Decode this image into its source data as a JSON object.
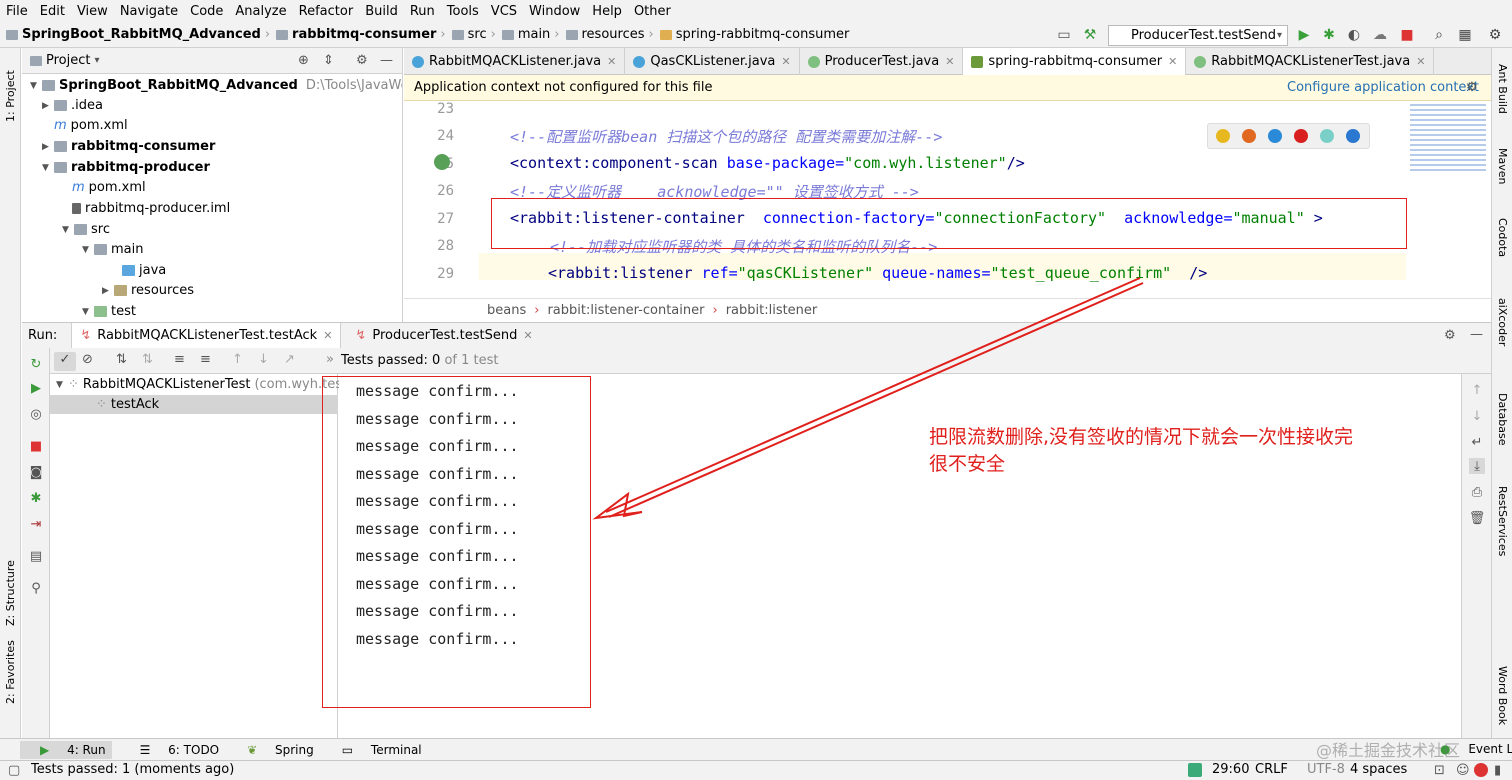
{
  "menu": [
    "File",
    "Edit",
    "View",
    "Navigate",
    "Code",
    "Analyze",
    "Refactor",
    "Build",
    "Run",
    "Tools",
    "VCS",
    "Window",
    "Help",
    "Other"
  ],
  "breadcrumbs": [
    "SpringBoot_RabbitMQ_Advanced",
    "rabbitmq-consumer",
    "src",
    "main",
    "resources",
    "spring-rabbitmq-consumer"
  ],
  "run_config": "ProducerTest.testSend",
  "left_strip": {
    "project": "1: Project",
    "structure": "Z: Structure",
    "favorites": "2: Favorites"
  },
  "right_strip": {
    "ant": "Ant Build",
    "maven": "Maven",
    "codota": "Codota",
    "aixcoder": "aiXcoder",
    "database": "Database",
    "rest": "RestServices",
    "wordbook": "Word Book"
  },
  "project": {
    "title": "Project",
    "root": "SpringBoot_RabbitMQ_Advanced",
    "root_path": "D:\\Tools\\JavaWorkSpace",
    "items": [
      ".idea",
      "pom.xml",
      "rabbitmq-consumer",
      "rabbitmq-producer",
      "pom.xml",
      "rabbitmq-producer.iml",
      "src",
      "main",
      "java",
      "resources",
      "test"
    ]
  },
  "tabs": [
    "RabbitMQACKListener.java",
    "QasCKListener.java",
    "ProducerTest.java",
    "spring-rabbitmq-consumer",
    "RabbitMQACKListenerTest.java"
  ],
  "banner": {
    "text": "Application context not configured for this file",
    "link": "Configure application context"
  },
  "line_numbers": [
    "23",
    "24",
    "25",
    "26",
    "27",
    "28",
    "29"
  ],
  "code": {
    "l24": "<!--配置监听器bean 扫描这个包的路径 配置类需要加注解-->",
    "l25_tag": "<context:component-scan",
    "l25_attr": " base-package=",
    "l25_val": "\"com.wyh.listener\"",
    "l25_end": "/>",
    "l26": "<!--定义监听器    acknowledge=\"\" 设置签收方式 -->",
    "l27_tag": "<rabbit:listener-container",
    "l27_a1": "  connection-factory=",
    "l27_v1": "\"connectionFactory\"",
    "l27_a2": "  acknowledge=",
    "l27_v2": "\"manual\"",
    "l27_end": " >",
    "l28": "<!--加载对应监听器的类 具体的类名和监听的队列名-->",
    "l29_tag": "<rabbit:listener",
    "l29_a1": " ref=",
    "l29_v1": "\"qasCKListener\"",
    "l29_a2": " queue-names=",
    "l29_v2": "\"test_queue_confirm\"",
    "l29_end": "  />"
  },
  "editor_breadcrumbs": [
    "beans",
    "rabbit:listener-container",
    "rabbit:listener"
  ],
  "run": {
    "label": "Run:",
    "tabs": [
      "RabbitMQACKListenerTest.testAck",
      "ProducerTest.testSend"
    ],
    "tests_passed_label": "Tests passed:",
    "tests_passed_count": "0",
    "tests_passed_of": "of 1 test",
    "tree_root": "RabbitMQACKListenerTest",
    "tree_root_pkg": "(com.wyh.test)",
    "tree_child": "testAck",
    "console_lines": [
      "message confirm...",
      "message confirm...",
      "message confirm...",
      "message confirm...",
      "message confirm...",
      "message confirm...",
      "message confirm...",
      "message confirm...",
      "message confirm...",
      "message confirm..."
    ]
  },
  "annotation": {
    "line1": "把限流数删除,没有签收的情况下就会一次性接收完",
    "line2": "很不安全"
  },
  "bottom_tabs": [
    "4: Run",
    "6: TODO",
    "Spring",
    "Terminal"
  ],
  "event_log": "Event Log",
  "watermark": "@稀土掘金技术社区",
  "status": {
    "message": "Tests passed: 1 (moments ago)",
    "position": "29:60",
    "line_sep": "CRLF",
    "encoding": "UTF-8",
    "indent": "4 spaces"
  },
  "colors": {
    "accent_red": "#e0201c",
    "comment": "#7a7ad8",
    "tag": "#000080",
    "attr": "#0000ff",
    "value": "#008000"
  }
}
